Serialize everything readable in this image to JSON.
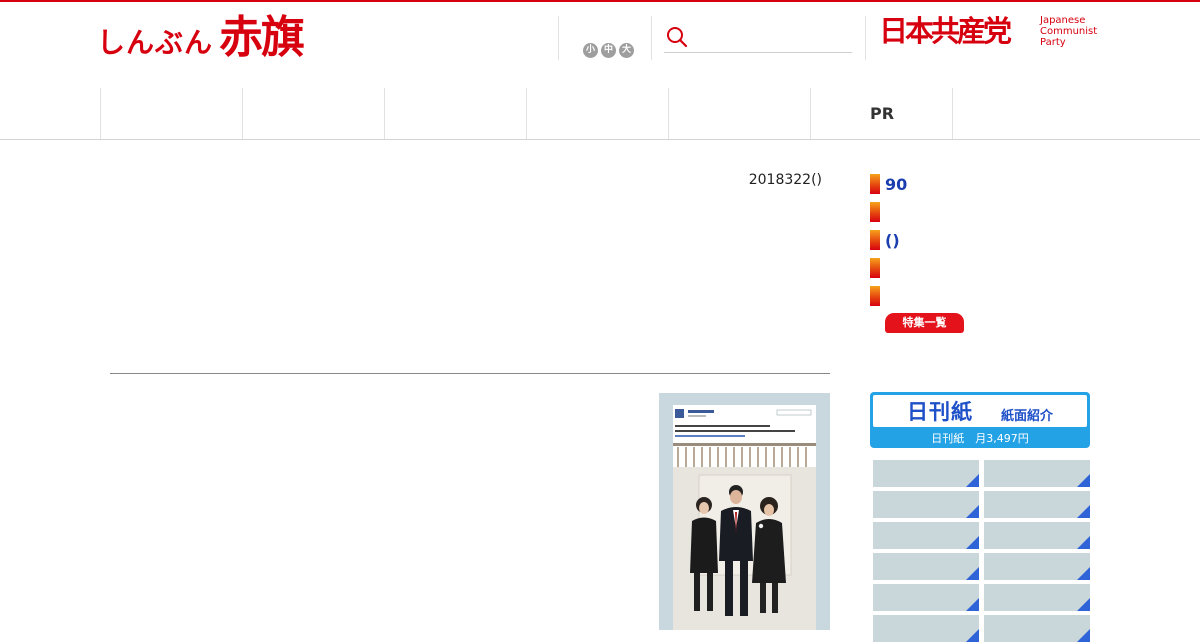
{
  "header": {
    "logo_kana": "しんぶん",
    "logo_kanji": "赤旗",
    "font_sizes": [
      "小",
      "中",
      "大"
    ],
    "search_placeholder": "",
    "party_name_jp": "日本共産党",
    "party_name_en": [
      "Japanese",
      "Communist",
      "Party"
    ]
  },
  "nav": {
    "items": [
      "",
      "",
      "",
      "",
      "",
      "PR",
      ""
    ]
  },
  "article": {
    "date": "2018322()"
  },
  "features": {
    "items": [
      "90",
      "",
      "()",
      "",
      ""
    ],
    "all_label": "特集一覧"
  },
  "banner": {
    "title": "日刊紙",
    "subtitle": "紙面紹介",
    "price": "日刊紙　月3,497円"
  },
  "colors": {
    "brand_red": "#d7000f",
    "link_blue": "#1a3eb0",
    "banner_blue": "#24a2e6"
  }
}
